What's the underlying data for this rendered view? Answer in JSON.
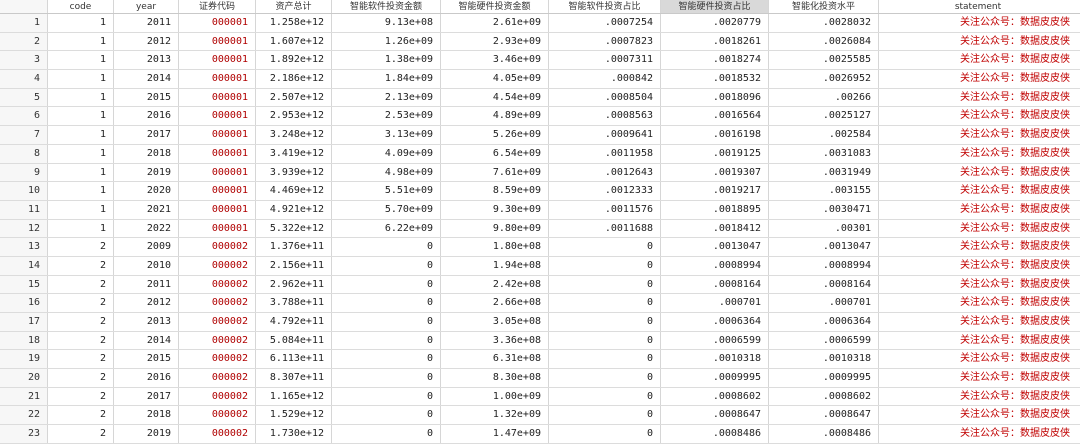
{
  "table": {
    "columns": [
      "",
      "code",
      "year",
      "证券代码",
      "资产总计",
      "智能软件投资金额",
      "智能硬件投资金额",
      "智能软件投资占比",
      "智能硬件投资占比",
      "智能化投资水平",
      "statement"
    ],
    "selected_column_index": 8,
    "rows": [
      [
        "1",
        "1",
        "2011",
        "000001",
        "1.258e+12",
        "9.13e+08",
        "2.61e+09",
        ".0007254",
        ".0020779",
        ".0028032",
        "关注公众号：数据皮皮侠"
      ],
      [
        "2",
        "1",
        "2012",
        "000001",
        "1.607e+12",
        "1.26e+09",
        "2.93e+09",
        ".0007823",
        ".0018261",
        ".0026084",
        "关注公众号：数据皮皮侠"
      ],
      [
        "3",
        "1",
        "2013",
        "000001",
        "1.892e+12",
        "1.38e+09",
        "3.46e+09",
        ".0007311",
        ".0018274",
        ".0025585",
        "关注公众号：数据皮皮侠"
      ],
      [
        "4",
        "1",
        "2014",
        "000001",
        "2.186e+12",
        "1.84e+09",
        "4.05e+09",
        ".000842",
        ".0018532",
        ".0026952",
        "关注公众号：数据皮皮侠"
      ],
      [
        "5",
        "1",
        "2015",
        "000001",
        "2.507e+12",
        "2.13e+09",
        "4.54e+09",
        ".0008504",
        ".0018096",
        ".00266",
        "关注公众号：数据皮皮侠"
      ],
      [
        "6",
        "1",
        "2016",
        "000001",
        "2.953e+12",
        "2.53e+09",
        "4.89e+09",
        ".0008563",
        ".0016564",
        ".0025127",
        "关注公众号：数据皮皮侠"
      ],
      [
        "7",
        "1",
        "2017",
        "000001",
        "3.248e+12",
        "3.13e+09",
        "5.26e+09",
        ".0009641",
        ".0016198",
        ".002584",
        "关注公众号：数据皮皮侠"
      ],
      [
        "8",
        "1",
        "2018",
        "000001",
        "3.419e+12",
        "4.09e+09",
        "6.54e+09",
        ".0011958",
        ".0019125",
        ".0031083",
        "关注公众号：数据皮皮侠"
      ],
      [
        "9",
        "1",
        "2019",
        "000001",
        "3.939e+12",
        "4.98e+09",
        "7.61e+09",
        ".0012643",
        ".0019307",
        ".0031949",
        "关注公众号：数据皮皮侠"
      ],
      [
        "10",
        "1",
        "2020",
        "000001",
        "4.469e+12",
        "5.51e+09",
        "8.59e+09",
        ".0012333",
        ".0019217",
        ".003155",
        "关注公众号：数据皮皮侠"
      ],
      [
        "11",
        "1",
        "2021",
        "000001",
        "4.921e+12",
        "5.70e+09",
        "9.30e+09",
        ".0011576",
        ".0018895",
        ".0030471",
        "关注公众号：数据皮皮侠"
      ],
      [
        "12",
        "1",
        "2022",
        "000001",
        "5.322e+12",
        "6.22e+09",
        "9.80e+09",
        ".0011688",
        ".0018412",
        ".00301",
        "关注公众号：数据皮皮侠"
      ],
      [
        "13",
        "2",
        "2009",
        "000002",
        "1.376e+11",
        "0",
        "1.80e+08",
        "0",
        ".0013047",
        ".0013047",
        "关注公众号：数据皮皮侠"
      ],
      [
        "14",
        "2",
        "2010",
        "000002",
        "2.156e+11",
        "0",
        "1.94e+08",
        "0",
        ".0008994",
        ".0008994",
        "关注公众号：数据皮皮侠"
      ],
      [
        "15",
        "2",
        "2011",
        "000002",
        "2.962e+11",
        "0",
        "2.42e+08",
        "0",
        ".0008164",
        ".0008164",
        "关注公众号：数据皮皮侠"
      ],
      [
        "16",
        "2",
        "2012",
        "000002",
        "3.788e+11",
        "0",
        "2.66e+08",
        "0",
        ".000701",
        ".000701",
        "关注公众号：数据皮皮侠"
      ],
      [
        "17",
        "2",
        "2013",
        "000002",
        "4.792e+11",
        "0",
        "3.05e+08",
        "0",
        ".0006364",
        ".0006364",
        "关注公众号：数据皮皮侠"
      ],
      [
        "18",
        "2",
        "2014",
        "000002",
        "5.084e+11",
        "0",
        "3.36e+08",
        "0",
        ".0006599",
        ".0006599",
        "关注公众号：数据皮皮侠"
      ],
      [
        "19",
        "2",
        "2015",
        "000002",
        "6.113e+11",
        "0",
        "6.31e+08",
        "0",
        ".0010318",
        ".0010318",
        "关注公众号：数据皮皮侠"
      ],
      [
        "20",
        "2",
        "2016",
        "000002",
        "8.307e+11",
        "0",
        "8.30e+08",
        "0",
        ".0009995",
        ".0009995",
        "关注公众号：数据皮皮侠"
      ],
      [
        "21",
        "2",
        "2017",
        "000002",
        "1.165e+12",
        "0",
        "1.00e+09",
        "0",
        ".0008602",
        ".0008602",
        "关注公众号：数据皮皮侠"
      ],
      [
        "22",
        "2",
        "2018",
        "000002",
        "1.529e+12",
        "0",
        "1.32e+09",
        "0",
        ".0008647",
        ".0008647",
        "关注公众号：数据皮皮侠"
      ],
      [
        "23",
        "2",
        "2019",
        "000002",
        "1.730e+12",
        "0",
        "1.47e+09",
        "0",
        ".0008486",
        ".0008486",
        "关注公众号：数据皮皮侠"
      ]
    ]
  }
}
